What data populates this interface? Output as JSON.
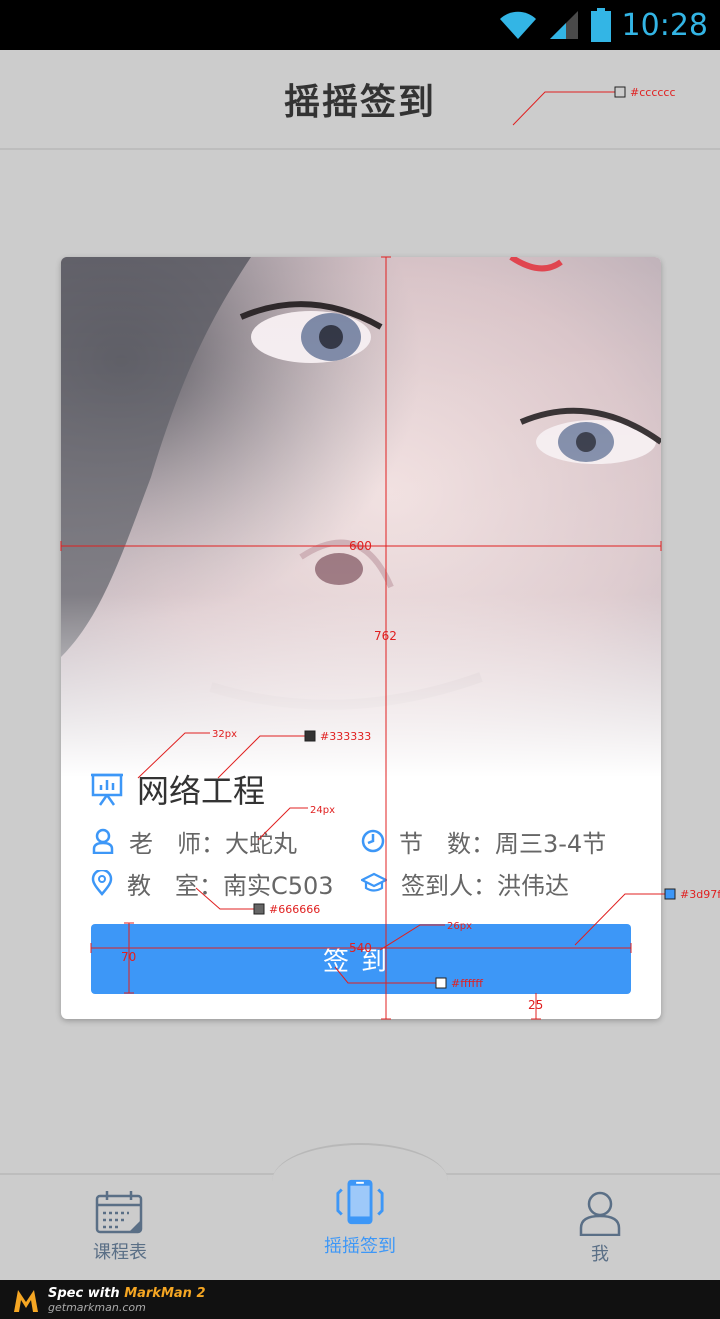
{
  "status_bar": {
    "time": "10:28"
  },
  "header": {
    "title": "摇摇签到"
  },
  "card": {
    "course_name": "网络工程",
    "info": {
      "teacher_label": "老　师：",
      "teacher": "大蛇丸",
      "period_label": "节　数：",
      "period": "周三3-4节",
      "room_label": "教　室：",
      "room": "南实C503",
      "signer_label": "签到人：",
      "signer": "洪伟达"
    },
    "sign_button": "签到"
  },
  "spec_annotations": {
    "title_bar_color": "#cccccc",
    "icon_size": "32px",
    "title_color": "#333333",
    "info_font": "24px",
    "info_color": "#666666",
    "button_color": "#3d97f7",
    "button_font": "26px",
    "button_text_color": "#ffffff",
    "card_width": "600",
    "card_height": "762",
    "button_width": "540",
    "button_height": "70",
    "bottom_margin": "25"
  },
  "tabs": [
    {
      "label": "课程表",
      "icon": "calendar-icon",
      "active": false
    },
    {
      "label": "摇摇签到",
      "icon": "phone-shake-icon",
      "active": true
    },
    {
      "label": "我",
      "icon": "person-icon",
      "active": false
    }
  ],
  "markman": {
    "title_prefix": "Spec with ",
    "title_brand": "MarkMan 2",
    "subtitle": "getmarkman.com"
  },
  "colors": {
    "accent": "#3d97f7",
    "background": "#cccccc",
    "title_text": "#333333",
    "info_text": "#666666",
    "status_time": "#33b5e5"
  }
}
